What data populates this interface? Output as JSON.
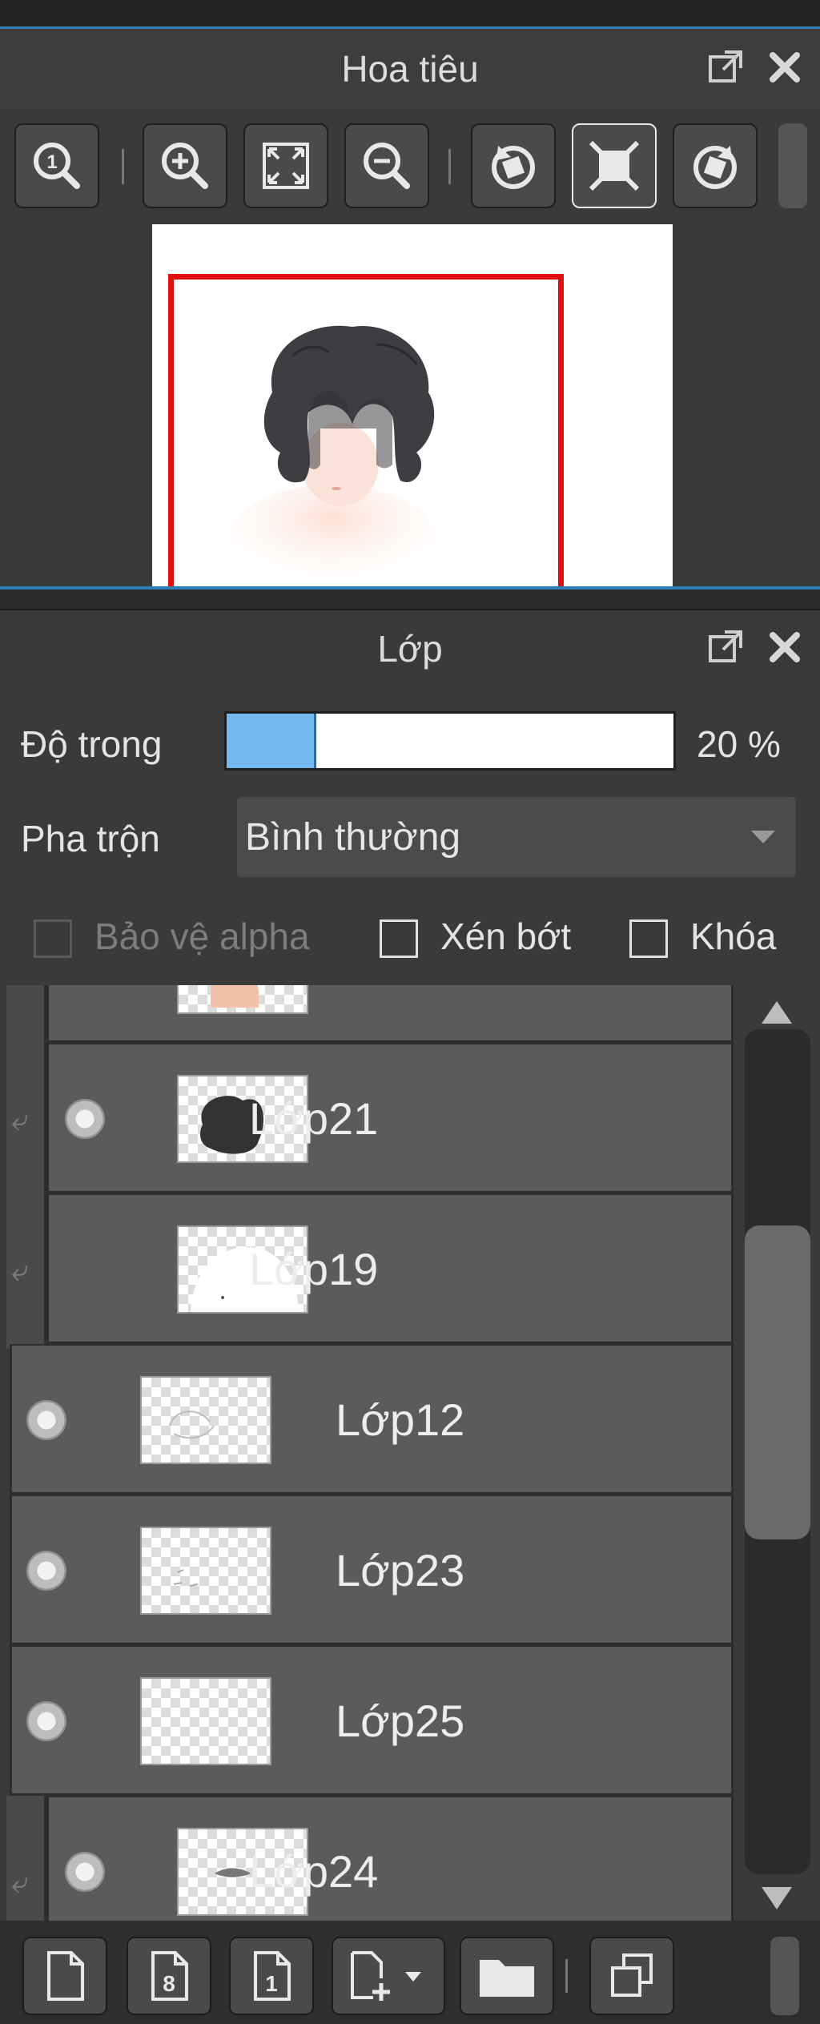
{
  "navigator": {
    "title": "Hoa tiêu",
    "tools": [
      "zoom-actual-icon",
      "zoom-in-icon",
      "fit-screen-icon",
      "zoom-out-icon",
      "rotate-left-icon",
      "rotate-reset-icon",
      "rotate-right-icon"
    ]
  },
  "layers_panel": {
    "title": "Lớp",
    "opacity_label": "Độ trong",
    "opacity_value": "20 %",
    "opacity_fraction": 0.2,
    "blend_label": "Pha trộn",
    "blend_value": "Bình thường",
    "protect_alpha_label": "Bảo vệ alpha",
    "clipping_label": "Xén bớt",
    "lock_label": "Khóa",
    "layers": [
      {
        "name": "",
        "visible": true,
        "clipped": true
      },
      {
        "name": "Lớp21",
        "visible": true,
        "clipped": true
      },
      {
        "name": "Lớp19",
        "visible": false,
        "clipped": true
      },
      {
        "name": "Lớp12",
        "visible": true,
        "clipped": false
      },
      {
        "name": "Lớp23",
        "visible": true,
        "clipped": false
      },
      {
        "name": "Lớp25",
        "visible": true,
        "clipped": false
      },
      {
        "name": "Lớp24",
        "visible": true,
        "clipped": true
      }
    ]
  },
  "bottom_tools": [
    "new-layer-icon",
    "new-8bit-layer-icon",
    "new-1bit-layer-icon",
    "add-layer-menu-icon",
    "new-folder-icon",
    "duplicate-layer-icon"
  ],
  "colors": {
    "accent": "#2e7fb8",
    "panel": "#3a3a3a",
    "layer_row": "#5b5b5b",
    "opacity_fill": "#74b8f0",
    "nav_frame": "#e01010"
  }
}
